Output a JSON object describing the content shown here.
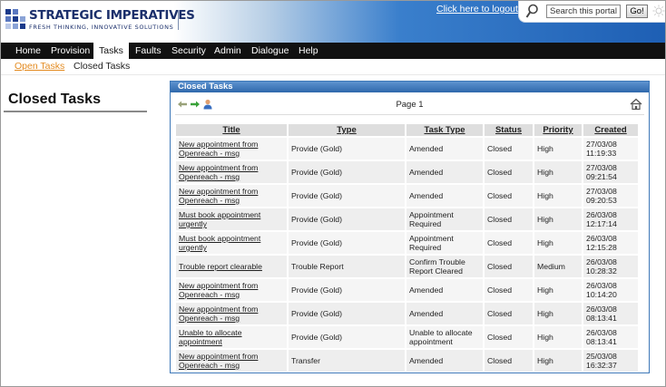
{
  "header": {
    "brand_title": "STRATEGIC IMPERATIVES",
    "brand_tagline": "FRESH THINKING, INNOVATIVE SOLUTIONS",
    "logout_link": "Click here to logout",
    "search": {
      "value": "Search this portal...",
      "go_label": "Go!"
    }
  },
  "nav": {
    "items": [
      {
        "label": "Home"
      },
      {
        "label": "Provision"
      },
      {
        "label": "Tasks",
        "active": true
      },
      {
        "label": "Faults"
      },
      {
        "label": "Security"
      },
      {
        "label": "Admin"
      },
      {
        "label": "Dialogue"
      },
      {
        "label": "Help"
      }
    ]
  },
  "subnav": {
    "open_tasks": "Open Tasks",
    "closed_tasks": "Closed Tasks"
  },
  "page": {
    "title": "Closed Tasks"
  },
  "panel": {
    "title": "Closed Tasks",
    "page_label": "Page 1",
    "columns": [
      "Title",
      "Type",
      "Task Type",
      "Status",
      "Priority",
      "Created"
    ],
    "rows": [
      {
        "title": "New appointment from Openreach - msg",
        "type": "Provide (Gold)",
        "task_type": "Amended",
        "status": "Closed",
        "priority": "High",
        "created_date": "27/03/08",
        "created_time": "11:19:33"
      },
      {
        "title": "New appointment from Openreach - msg",
        "type": "Provide (Gold)",
        "task_type": "Amended",
        "status": "Closed",
        "priority": "High",
        "created_date": "27/03/08",
        "created_time": "09:21:54"
      },
      {
        "title": "New appointment from Openreach - msg",
        "type": "Provide (Gold)",
        "task_type": "Amended",
        "status": "Closed",
        "priority": "High",
        "created_date": "27/03/08",
        "created_time": "09:20:53"
      },
      {
        "title": "Must book appointment urgently",
        "type": "Provide (Gold)",
        "task_type": "Appointment Required",
        "status": "Closed",
        "priority": "High",
        "created_date": "26/03/08",
        "created_time": "12:17:14"
      },
      {
        "title": "Must book appointment urgently",
        "type": "Provide (Gold)",
        "task_type": "Appointment Required",
        "status": "Closed",
        "priority": "High",
        "created_date": "26/03/08",
        "created_time": "12:15:28"
      },
      {
        "title": "Trouble report clearable",
        "type": "Trouble Report",
        "task_type": "Confirm Trouble Report Cleared",
        "status": "Closed",
        "priority": "Medium",
        "created_date": "26/03/08",
        "created_time": "10:28:32"
      },
      {
        "title": "New appointment from Openreach - msg",
        "type": "Provide (Gold)",
        "task_type": "Amended",
        "status": "Closed",
        "priority": "High",
        "created_date": "26/03/08",
        "created_time": "10:14:20"
      },
      {
        "title": "New appointment from Openreach - msg",
        "type": "Provide (Gold)",
        "task_type": "Amended",
        "status": "Closed",
        "priority": "High",
        "created_date": "26/03/08",
        "created_time": "08:13:41"
      },
      {
        "title": "Unable to allocate appointment",
        "type": "Provide (Gold)",
        "task_type": "Unable to allocate appointment",
        "status": "Closed",
        "priority": "High",
        "created_date": "26/03/08",
        "created_time": "08:13:41"
      },
      {
        "title": "New appointment from Openreach - msg",
        "type": "Transfer",
        "task_type": "Amended",
        "status": "Closed",
        "priority": "High",
        "created_date": "25/03/08",
        "created_time": "16:32:37"
      }
    ]
  },
  "colors": {
    "accent_link": "#e38a1f",
    "header_blue": "#1e5fb4",
    "panel_blue": "#3e78b8",
    "nav_bg": "#111111"
  },
  "icons": [
    "search-icon",
    "sun-icon",
    "back-arrow-icon",
    "forward-arrow-icon",
    "user-icon",
    "home-icon"
  ]
}
